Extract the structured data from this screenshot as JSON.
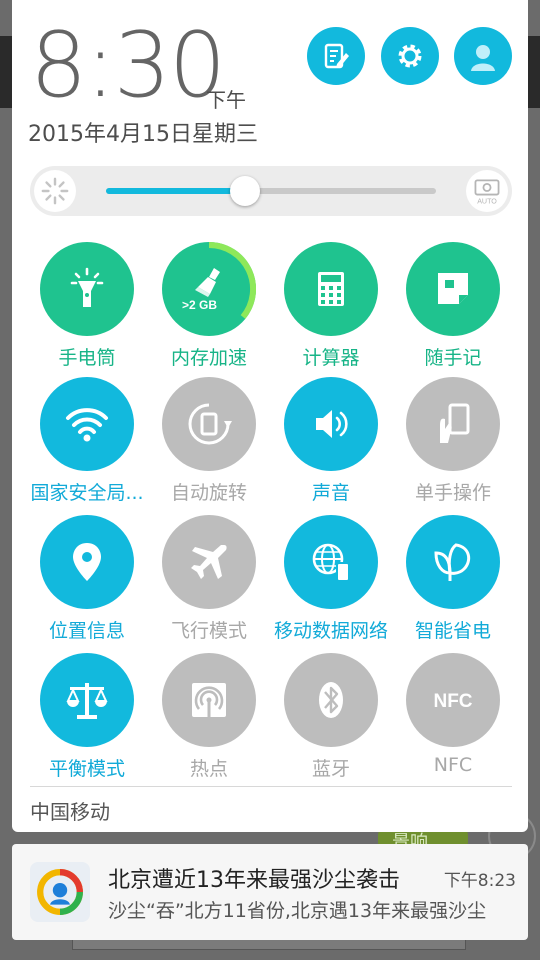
{
  "status": {
    "time": "8:30",
    "ampm": "下午",
    "date": "2015年4月15日星期三"
  },
  "top_buttons": [
    {
      "name": "edit-icon"
    },
    {
      "name": "gear-icon"
    },
    {
      "name": "avatar-icon"
    }
  ],
  "brightness": {
    "level": 0.42,
    "auto_label": "AUTO"
  },
  "tiles": [
    {
      "label": "手电筒",
      "state": "on-green",
      "icon": "flashlight-icon"
    },
    {
      "label": "内存加速",
      "state": "on-green",
      "icon": "broom-icon",
      "badge": ">2 GB"
    },
    {
      "label": "计算器",
      "state": "on-green",
      "icon": "calculator-icon"
    },
    {
      "label": "随手记",
      "state": "on-green",
      "icon": "note-icon"
    },
    {
      "label": "国家安全局...",
      "state": "on",
      "icon": "wifi-icon"
    },
    {
      "label": "自动旋转",
      "state": "off",
      "icon": "rotate-icon"
    },
    {
      "label": "声音",
      "state": "on",
      "icon": "sound-icon"
    },
    {
      "label": "单手操作",
      "state": "off",
      "icon": "one-hand-icon"
    },
    {
      "label": "位置信息",
      "state": "on",
      "icon": "location-icon"
    },
    {
      "label": "飞行模式",
      "state": "off",
      "icon": "airplane-icon"
    },
    {
      "label": "移动数据网络",
      "state": "on",
      "icon": "mobile-data-icon"
    },
    {
      "label": "智能省电",
      "state": "on",
      "icon": "leaf-icon"
    },
    {
      "label": "平衡模式",
      "state": "on",
      "icon": "balance-icon"
    },
    {
      "label": "热点",
      "state": "off",
      "icon": "hotspot-icon"
    },
    {
      "label": "蓝牙",
      "state": "off",
      "icon": "bluetooth-icon"
    },
    {
      "label": "NFC",
      "state": "off",
      "icon": "nfc-icon"
    }
  ],
  "carrier": "中国移动",
  "notification": {
    "title": "北京遭近13年来最强沙尘袭击",
    "time": "下午8:23",
    "body": "沙尘“吞”北方11省份,北京遇13年来最强沙尘"
  },
  "background": {
    "button_label": "景响"
  },
  "colors": {
    "accent_blue": "#12b9dd",
    "accent_green": "#1fc38f",
    "off_gray": "#bdbdbd"
  }
}
